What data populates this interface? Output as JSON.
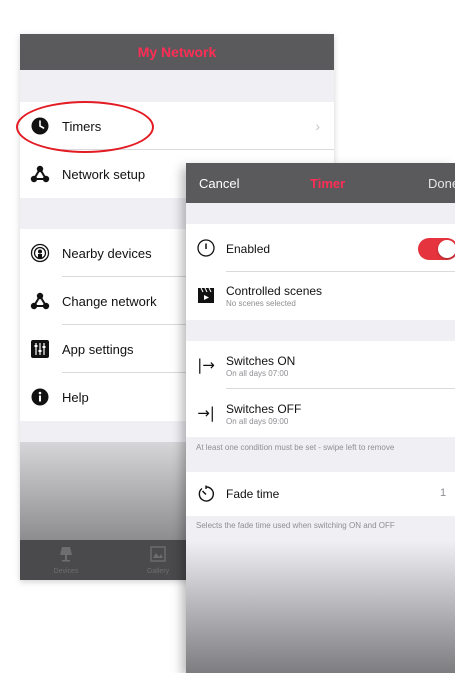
{
  "my_network": {
    "title": "My Network",
    "items": [
      {
        "label": "Timers",
        "icon": "clock-icon"
      },
      {
        "label": "Network setup",
        "icon": "network-icon"
      },
      {
        "label": "Nearby devices",
        "icon": "nearby-icon"
      },
      {
        "label": "Change network",
        "icon": "network-icon"
      },
      {
        "label": "App settings",
        "icon": "sliders-icon"
      },
      {
        "label": "Help",
        "icon": "info-icon"
      }
    ],
    "tabs": [
      {
        "label": "Devices",
        "icon": "lamp-icon"
      },
      {
        "label": "Gallery",
        "icon": "gallery-icon"
      }
    ]
  },
  "timer": {
    "cancel_label": "Cancel",
    "title": "Timer",
    "done_label": "Done",
    "enabled": {
      "label": "Enabled",
      "value": true,
      "icon": "power-icon"
    },
    "controlled_scenes": {
      "label": "Controlled scenes",
      "subtitle": "No scenes selected",
      "icon": "clapperboard-icon"
    },
    "switches_on": {
      "label": "Switches ON",
      "subtitle": "On all days  07:00",
      "icon": "arrow-right-bar-icon"
    },
    "switches_off": {
      "label": "Switches OFF",
      "subtitle": "On all days  09:00",
      "icon": "arrow-to-bar-icon"
    },
    "conditions_note": "At least one condition must be set - swipe left to remove",
    "fade_time": {
      "label": "Fade time",
      "value": "1",
      "icon": "timer-icon"
    },
    "fade_note": "Selects the fade time used when switching ON and OFF"
  },
  "colors": {
    "accent": "#ff2d55",
    "highlight_ring": "#e31b23",
    "toggle_on": "#e5343d",
    "navbar": "#5a5a5c"
  }
}
